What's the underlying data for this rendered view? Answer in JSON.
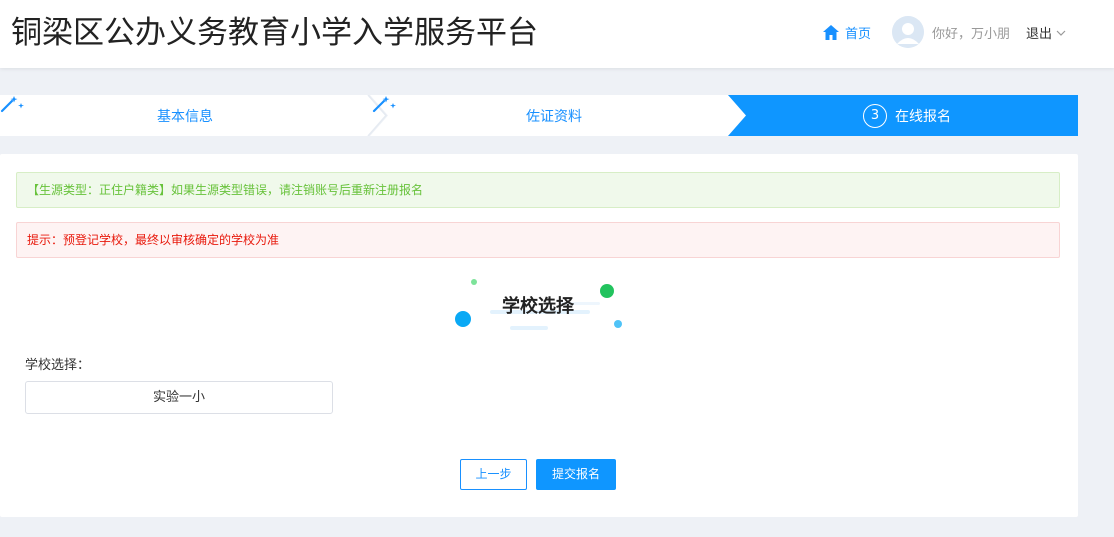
{
  "header": {
    "title": "铜梁区公办义务教育小学入学服务平台",
    "home_label": "首页",
    "greeting": "你好，万小朋",
    "logout_label": "退出"
  },
  "steps": [
    {
      "label": "基本信息",
      "status": "done"
    },
    {
      "label": "佐证资料",
      "status": "done"
    },
    {
      "number": "3",
      "label": "在线报名",
      "status": "active"
    }
  ],
  "alerts": {
    "success": "【生源类型：正住户籍类】如果生源类型错误，请注销账号后重新注册报名",
    "error": "提示：预登记学校，最终以审核确定的学校为准"
  },
  "section": {
    "title": "学校选择",
    "field_label": "学校选择：",
    "field_value": "实验一小"
  },
  "buttons": {
    "prev": "上一步",
    "submit": "提交报名"
  },
  "colors": {
    "primary": "#1890ff",
    "active_step": "#0f96ff",
    "success_text": "#67c23a",
    "error_text": "#e8190c"
  },
  "icons": [
    "home-icon",
    "user-avatar-icon",
    "chevron-down-icon",
    "magic-wand-icon"
  ]
}
